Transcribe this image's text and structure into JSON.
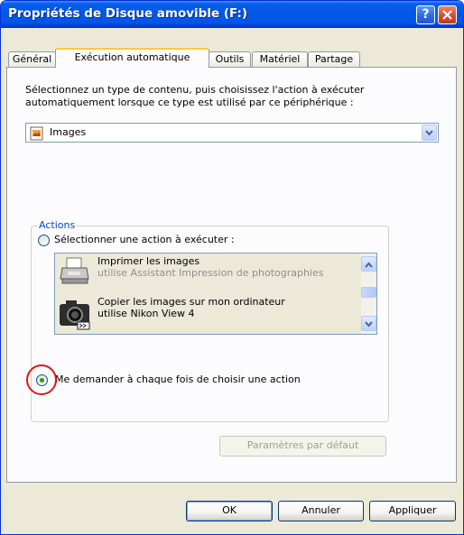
{
  "window": {
    "title": "Propriétés de Disque amovible (F:)",
    "help_glyph": "?",
    "colors": {
      "titlebar": "#0058e6",
      "face": "#ece9d8",
      "highlight_circle": "#e01818"
    }
  },
  "tabs": [
    {
      "label": "Général",
      "active": false
    },
    {
      "label": "Exécution automatique",
      "active": true
    },
    {
      "label": "Outils",
      "active": false
    },
    {
      "label": "Matériel",
      "active": false
    },
    {
      "label": "Partage",
      "active": false
    }
  ],
  "autoplay": {
    "description": "Sélectionnez un type de contenu, puis choisissez l'action à exécuter automatiquement lorsque ce type est utilisé par ce périphérique :",
    "content_type": {
      "selected": "Images",
      "icon": "image-file-icon"
    },
    "actions": {
      "legend": "Actions",
      "option_select": {
        "label": "Sélectionner une action à exécuter :",
        "checked": false
      },
      "list": [
        {
          "title": "Imprimer les images",
          "subtitle": "utilise Assistant Impression de photographies",
          "icon": "printer-icon"
        },
        {
          "title": "Copier les images sur mon ordinateur",
          "subtitle": "utilise Nikon View 4",
          "icon": "camera-icon"
        }
      ],
      "option_ask": {
        "label": "Me demander à chaque fois de choisir une action",
        "checked": true
      }
    },
    "defaults_button": "Paramètres par défaut"
  },
  "footer": {
    "ok": "OK",
    "cancel": "Annuler",
    "apply": "Appliquer"
  }
}
